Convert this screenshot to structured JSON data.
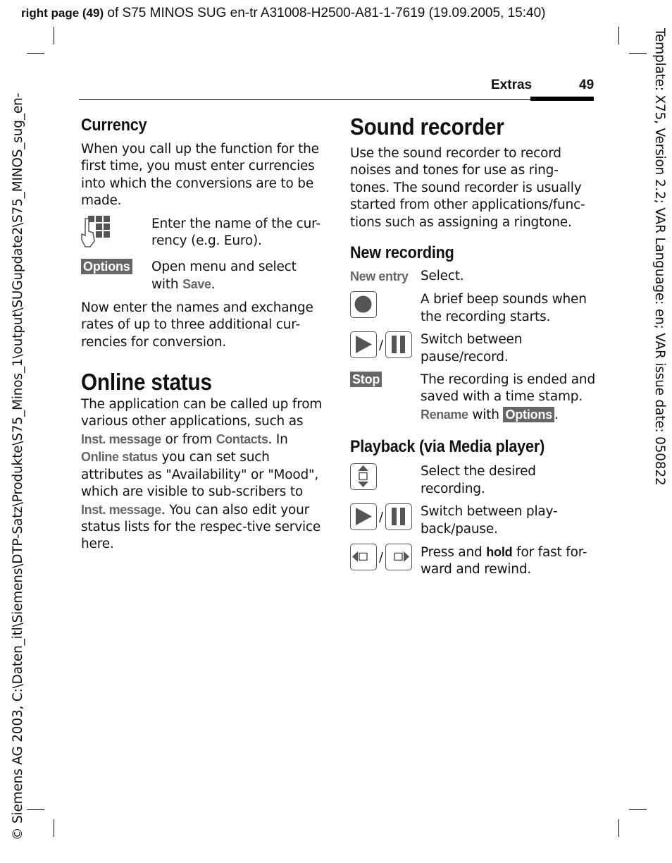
{
  "top_line": {
    "bold": "right page (49)",
    "rest": " of S75 MINOS SUG en-tr A31008-H2500-A81-1-7619 (19.09.2005, 15:40)"
  },
  "header": {
    "section": "Extras",
    "page": "49"
  },
  "left_side": "© Siemens AG 2003, C:\\Daten_itl\\Siemens\\DTP-Satz\\Produkte\\S75_Minos_1\\output\\SUGupdate2\\S75_MINOS_sug_en-",
  "right_side": "Template: X75, Version 2.2; VAR Language: en; VAR issue date: 050822",
  "currency": {
    "title": "Currency",
    "intro": "When you call up the function for the first time, you must enter currencies into which the conversions are to be made.",
    "row1": "Enter the name of the cur-rency (e.g.  Euro).",
    "row2_key": "Options",
    "row2_a": "Open menu and select with ",
    "row2_kw": "Save",
    "row2_b": ".",
    "outro": "Now enter the names and exchange rates of up to three additional cur-rencies for conversion."
  },
  "online": {
    "title": "Online status",
    "t1": "The application can be called up from various other applications, such as ",
    "k1": "Inst. message",
    "t2": " or from ",
    "k2": "Contacts",
    "t3": ". In ",
    "k3": "Online status",
    "t4": " you can set such attributes as \"Availability\" or \"Mood\", which are visible to sub-scribers to ",
    "k4": "Inst. message",
    "t5": ". You can also edit your status lists for the respec-tive service here."
  },
  "recorder": {
    "title": "Sound recorder",
    "intro": "Use the sound recorder to record noises and tones for use as ring-tones. The sound recorder is usually started from other applications/func-tions such as assigning a ringtone.",
    "new_title": "New recording",
    "new_entry_key": "New entry",
    "new_entry_text": "Select.",
    "record_text": "A brief beep sounds when the recording starts.",
    "switch_text": "Switch between pause/record.",
    "stop_key": "Stop",
    "stop_a": "The recording is ended and saved with a time stamp. ",
    "stop_kw": "Rename",
    "stop_b": " with ",
    "stop_soft": "Options",
    "stop_c": ".",
    "play_title": "Playback (via Media player)",
    "select_text": "Select the desired recording.",
    "play_text": "Switch between play-back/pause.",
    "ff_a": "Press and ",
    "ff_bold": "hold",
    "ff_b": " for fast for-ward and rewind.",
    "slash": "/"
  },
  "colors": {
    "icon": "#555555",
    "keyword": "#666666"
  }
}
